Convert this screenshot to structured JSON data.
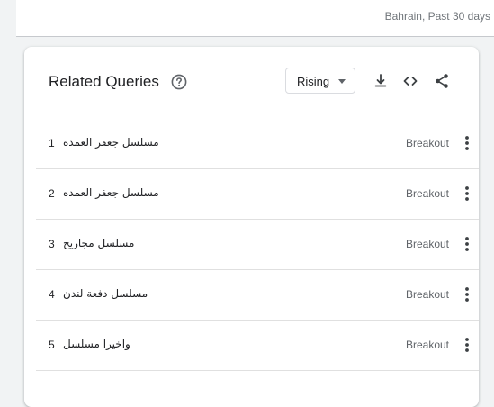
{
  "header": {
    "region_time": "Bahrain, Past 30 days"
  },
  "card": {
    "title": "Related Queries",
    "filter": {
      "selected": "Rising"
    },
    "icons": [
      "help-icon",
      "download-icon",
      "embed-icon",
      "share-icon",
      "more-vert-icon"
    ],
    "rows": [
      {
        "rank": "1",
        "query": "مسلسل جعفر العمده",
        "value": "Breakout"
      },
      {
        "rank": "2",
        "query": "مسلسل جعفر العمده",
        "value": "Breakout"
      },
      {
        "rank": "3",
        "query": "مسلسل مجاريح",
        "value": "Breakout"
      },
      {
        "rank": "4",
        "query": "مسلسل دفعة لندن",
        "value": "Breakout"
      },
      {
        "rank": "5",
        "query": "واخيرا مسلسل",
        "value": "Breakout"
      }
    ]
  },
  "colors": {
    "background": "#f1f3f4",
    "card": "#ffffff",
    "text": "#202124",
    "secondary_text": "#5f6368",
    "divider": "#e0e0e0"
  }
}
